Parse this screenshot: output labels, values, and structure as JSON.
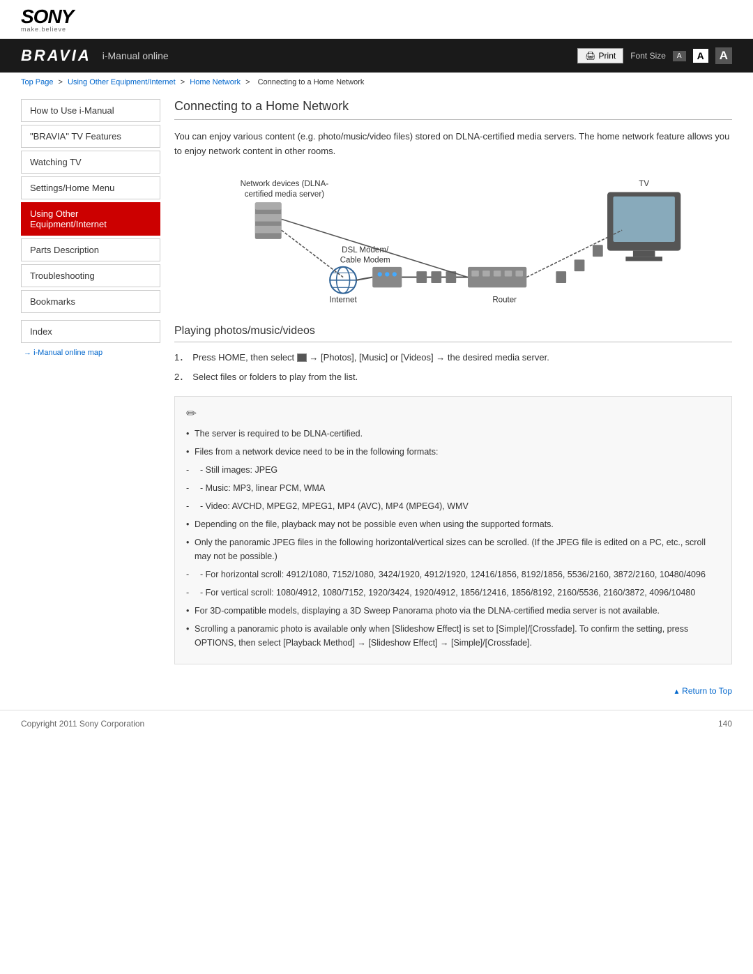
{
  "header": {
    "sony_text": "SONY",
    "tagline": "make.believe",
    "bravia_logo": "BRAVIA",
    "nav_title": "i-Manual online",
    "print_label": "Print",
    "font_size_label": "Font Size",
    "font_size_small": "A",
    "font_size_medium": "A",
    "font_size_large": "A"
  },
  "breadcrumb": {
    "items": [
      "Top Page",
      "Using Other Equipment/Internet",
      "Home Network",
      "Connecting to a Home Network"
    ],
    "separators": [
      " > ",
      " > ",
      " > "
    ]
  },
  "sidebar": {
    "items": [
      {
        "label": "How to Use i-Manual",
        "active": false
      },
      {
        "label": "\"BRAVIA\" TV Features",
        "active": false
      },
      {
        "label": "Watching TV",
        "active": false
      },
      {
        "label": "Settings/Home Menu",
        "active": false
      },
      {
        "label": "Using Other Equipment/Internet",
        "active": true
      },
      {
        "label": "Parts Description",
        "active": false
      },
      {
        "label": "Troubleshooting",
        "active": false
      },
      {
        "label": "Bookmarks",
        "active": false
      }
    ],
    "index_label": "Index",
    "map_link": "i-Manual online map"
  },
  "content": {
    "page_title": "Connecting to a Home Network",
    "intro_text": "You can enjoy various content (e.g. photo/music/video files) stored on DLNA-certified media servers. The home network feature allows you to enjoy network content in other rooms.",
    "diagram": {
      "labels": {
        "network_devices": "Network devices (DLNA-\ncertified media server)",
        "dsl_modem": "DSL Modem/\nCable Modem",
        "internet": "Internet",
        "router": "Router",
        "tv": "TV"
      }
    },
    "sub_title": "Playing photos/music/videos",
    "steps": [
      {
        "num": "1．",
        "text": "Press HOME, then select  → [Photos], [Music] or [Videos] → the desired media server."
      },
      {
        "num": "2．",
        "text": "Select files or folders to play from the list."
      }
    ],
    "notes": {
      "icon": "🖊",
      "items": [
        {
          "text": "The server is required to be DLNA-certified.",
          "sub": false
        },
        {
          "text": "Files from a network device need to be in the following formats:",
          "sub": false
        },
        {
          "text": "- Still images: JPEG",
          "sub": true
        },
        {
          "text": "- Music: MP3, linear PCM, WMA",
          "sub": true
        },
        {
          "text": "- Video: AVCHD, MPEG2, MPEG1, MP4 (AVC), MP4 (MPEG4), WMV",
          "sub": true
        },
        {
          "text": "Depending on the file, playback may not be possible even when using the supported formats.",
          "sub": false
        },
        {
          "text": "Only the panoramic JPEG files in the following horizontal/vertical sizes can be scrolled. (If the JPEG file is edited on a PC, etc., scroll may not be possible.)",
          "sub": false
        },
        {
          "text": "- For horizontal scroll: 4912/1080, 7152/1080, 3424/1920, 4912/1920, 12416/1856, 8192/1856, 5536/2160, 3872/2160, 10480/4096",
          "sub": true
        },
        {
          "text": "- For vertical scroll: 1080/4912, 1080/7152, 1920/3424, 1920/4912, 1856/12416, 1856/8192, 2160/5536, 2160/3872, 4096/10480",
          "sub": true
        },
        {
          "text": "For 3D-compatible models, displaying a 3D Sweep Panorama photo via the DLNA-certified media server is not available.",
          "sub": false
        },
        {
          "text": "Scrolling a panoramic photo is available only when [Slideshow Effect] is set to [Simple]/[Crossfade]. To confirm the setting, press OPTIONS, then select [Playback Method] → [Slideshow Effect] → [Simple]/[Crossfade].",
          "sub": false
        }
      ]
    }
  },
  "footer": {
    "return_top": "Return to Top",
    "copyright": "Copyright 2011 Sony Corporation",
    "page_number": "140"
  }
}
